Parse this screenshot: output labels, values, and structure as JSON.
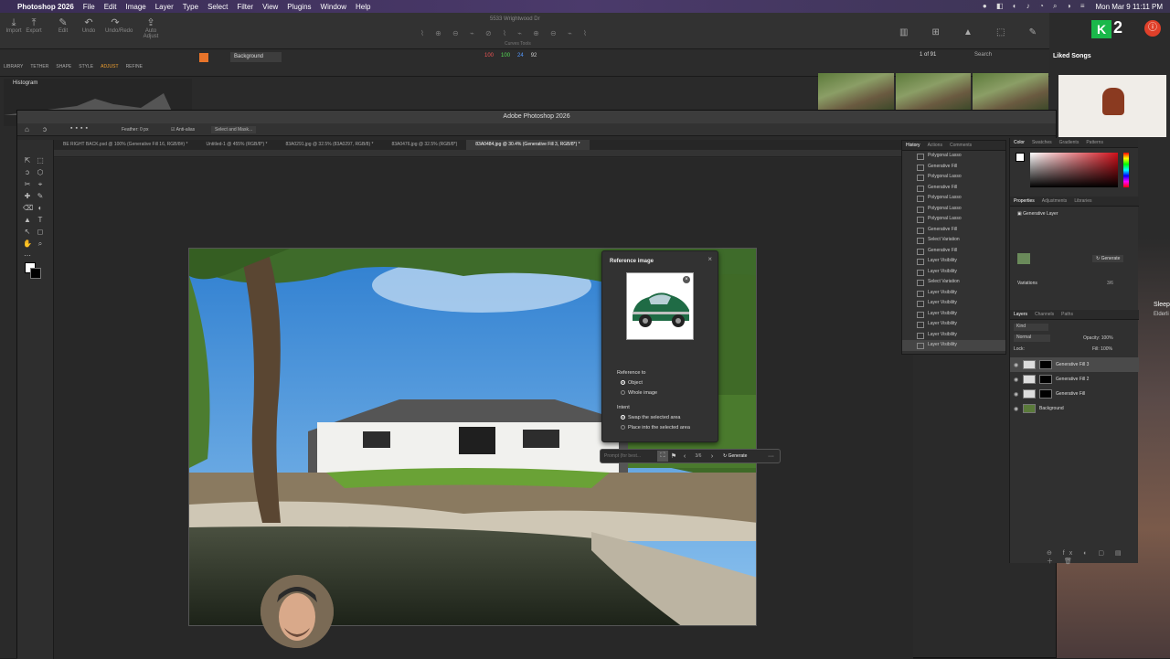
{
  "menubar": {
    "app_name": "Photoshop 2026",
    "items": [
      "File",
      "Edit",
      "Image",
      "Layer",
      "Type",
      "Select",
      "Filter",
      "View",
      "Plugins",
      "Window",
      "Help"
    ],
    "clock": "Mon Mar 9  11:11 PM"
  },
  "lightroom": {
    "window_title": "5533 Wrightwood Dr",
    "tools": [
      "Import",
      "Export",
      "Edit",
      "Undo",
      "Redo",
      "Undo/Redo",
      "Auto Adjust"
    ],
    "modules": [
      "LIBRARY",
      "TETHER",
      "SHAPE",
      "STYLE",
      "ADJUST",
      "REFINE"
    ],
    "histogram_label": "Histogram",
    "layer_select": "Background",
    "counter": "1 of 91",
    "search_label": "Search",
    "rgb_values": [
      "100",
      "100",
      "24",
      "92"
    ],
    "curves_label": "Curves Tools",
    "right_tools": [
      "Before",
      "Grid",
      "Exp. Warning",
      "Learn",
      "Copy/Apply"
    ]
  },
  "mac_side": {
    "playlist_title": "Liked Songs",
    "badge_number": "2",
    "sleep_text": "Sleep",
    "sleep_sub": "Elderli"
  },
  "photoshop": {
    "window_title": "Adobe Photoshop 2026",
    "options": {
      "feather": "Feather: 0 px",
      "antialias": "Anti-alias",
      "select_mask": "Select and Mask..."
    },
    "tabs": [
      "BE RIGHT BACK.psd @ 100% (Generative Fill 16, RGB/8#) *",
      "Untitled-1 @ 455% (RGB/8*) *",
      "83A0291.jpg @ 32.5% (83A0297, RGB/8) *",
      "83A0476.jpg @ 32.5% (RGB/8*)",
      "83A0484.jpg @ 30.4% (Generative Fill 3, RGB/8*) *"
    ],
    "active_tab_index": 4
  },
  "history_panel": {
    "tabs": [
      "History",
      "Actions",
      "Comments"
    ],
    "items": [
      "Polygonal Lasso",
      "Generative Fill",
      "Polygonal Lasso",
      "Generative Fill",
      "Polygonal Lasso",
      "Polygonal Lasso",
      "Polygonal Lasso",
      "Generative Fill",
      "Select Variation",
      "Generative Fill",
      "Layer Visibility",
      "Layer Visibility",
      "Select Variation",
      "Layer Visibility",
      "Layer Visibility",
      "Layer Visibility",
      "Layer Visibility",
      "Layer Visibility",
      "Layer Visibility"
    ],
    "selected_index": 18
  },
  "color_panel": {
    "tabs": [
      "Color",
      "Swatches",
      "Gradients",
      "Patterns"
    ]
  },
  "properties_panel": {
    "tabs": [
      "Properties",
      "Adjustments",
      "Libraries"
    ],
    "layer_type": "Generative Layer",
    "generate_button": "Generate",
    "variations_label": "Variations",
    "variation_count": "3/6"
  },
  "layers_panel": {
    "tabs": [
      "Layers",
      "Channels",
      "Paths"
    ],
    "kind_label": "Kind",
    "blend_mode": "Normal",
    "opacity": "Opacity: 100%",
    "lock_label": "Lock:",
    "fill": "Fill: 100%",
    "layers": [
      "Generative Fill 3",
      "Generative Fill 2",
      "Generative Fill",
      "Background"
    ],
    "selected_index": 0
  },
  "reference_dialog": {
    "title": "Reference image",
    "reference_to_label": "Reference to",
    "reference_options": [
      "Object",
      "Whole image"
    ],
    "reference_selected": 0,
    "intent_label": "Intent",
    "intent_options": [
      "Swap the selected area",
      "Place into the selected area"
    ],
    "intent_selected": 0
  },
  "generate_bar": {
    "prompt_placeholder": "Prompt (for best...",
    "counter": "3/6",
    "generate_label": "Generate",
    "more_label": "···"
  },
  "colors": {
    "accent": "#1473e6",
    "generate_blue": "#1473e6",
    "ps_bg": "#282828"
  }
}
